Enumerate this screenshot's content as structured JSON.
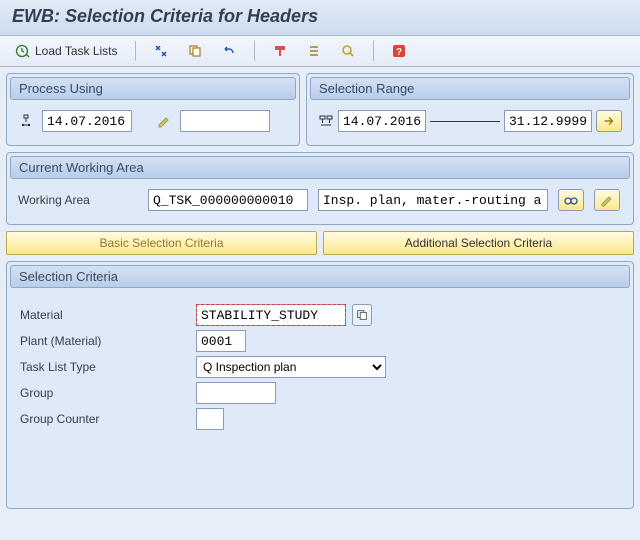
{
  "title": "EWB: Selection Criteria for Headers",
  "toolbar": {
    "load_task_lists": "Load Task Lists"
  },
  "process_using": {
    "header": "Process Using",
    "key_date": "14.07.2016",
    "change_number": ""
  },
  "selection_range": {
    "header": "Selection Range",
    "from": "14.07.2016",
    "to": "31.12.9999"
  },
  "working_area": {
    "header": "Current Working Area",
    "label": "Working Area",
    "id": "Q_TSK_000000000010",
    "desc": "Insp. plan, mater.-routing alloc., l…"
  },
  "tabs": {
    "basic": "Basic Selection Criteria",
    "additional": "Additional Selection Criteria"
  },
  "criteria": {
    "header": "Selection Criteria",
    "material_label": "Material",
    "material": "STABILITY_STUDY",
    "plant_label": "Plant (Material)",
    "plant": "0001",
    "tasklisttype_label": "Task List Type",
    "tasklisttype": "Q Inspection plan",
    "group_label": "Group",
    "group": "",
    "groupcounter_label": "Group Counter",
    "groupcounter": ""
  }
}
